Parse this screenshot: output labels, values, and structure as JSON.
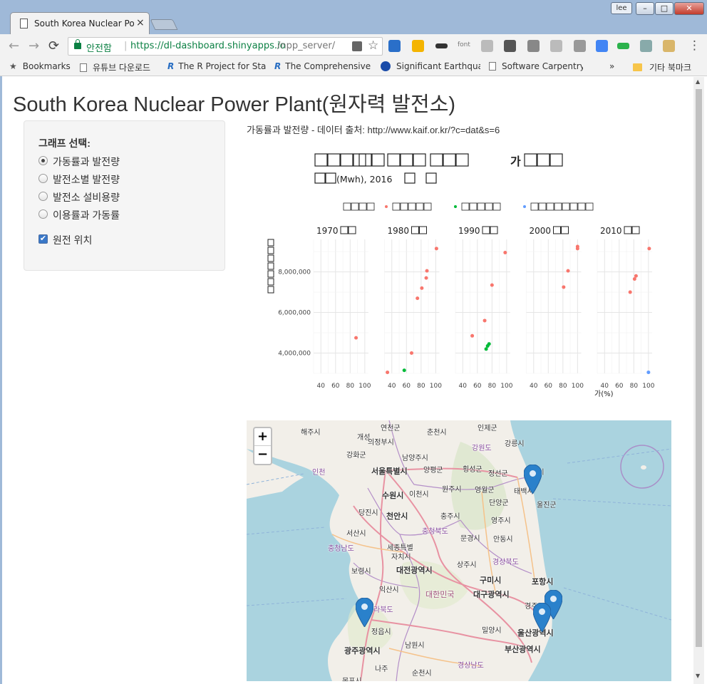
{
  "browser": {
    "tab_title": "South Korea Nuclear Po",
    "tab_close": "×",
    "user": "lee",
    "window_buttons": [
      "–",
      "□",
      "✕"
    ],
    "nav_back": "←",
    "nav_forward": "→",
    "nav_reload": "⟳",
    "secure_label": "안전함",
    "url_separator": "|",
    "url_host": "https://dl-dashboard.shinyapps.io",
    "url_path": "/npp_server/",
    "font_ext_label": "font",
    "bookmarks": [
      {
        "icon": "star-icon",
        "label": "Bookmarks"
      },
      {
        "icon": "page-icon",
        "label": "유튜브 다운로드"
      },
      {
        "icon": "r-logo-icon",
        "label": "The R Project for Sta"
      },
      {
        "icon": "r-logo-icon",
        "label": "The Comprehensive"
      },
      {
        "icon": "usgs-globe-icon",
        "label": "Significant Earthquak"
      },
      {
        "icon": "page-icon",
        "label": "Software Carpentry:"
      }
    ],
    "bookmarks_overflow": "»",
    "other_bookmarks": "기타 북마크"
  },
  "page": {
    "title": "South Korea Nuclear Power Plant(원자력 발전소)",
    "sidebar": {
      "label": "그래프 선택:",
      "options": [
        {
          "label": "가동률과 발전량",
          "selected": true
        },
        {
          "label": "발전소별 발전량",
          "selected": false
        },
        {
          "label": "발전소 설비용량",
          "selected": false
        },
        {
          "label": "이용률과 가동률",
          "selected": false
        }
      ],
      "checkbox": {
        "label": "원전 위치",
        "checked": true
      }
    },
    "source_text": "가동률과 발전량 - 데이터 출처: http://www.kaif.or.kr/?c=dat&s=6"
  },
  "chart_data": {
    "type": "scatter",
    "title": "",
    "subtitle": "(Mwh), 2016",
    "facets": [
      "1970",
      "1980",
      "1990",
      "2000",
      "2010"
    ],
    "xlim": [
      30,
      105
    ],
    "ylim": [
      3000000,
      9600000
    ],
    "x_ticks": [
      40,
      60,
      80,
      100
    ],
    "y_ticks": [
      4000000,
      6000000,
      8000000
    ],
    "y_tick_labels": [
      "4,000,000",
      "6,000,000",
      "8,000,000"
    ],
    "xlabel": "가(%)",
    "ylabel": "",
    "legend_position": "top",
    "grid": true,
    "series": [
      {
        "color": "#f8766d",
        "points": [
          {
            "facet": 0,
            "x": 88,
            "y": 4750000
          },
          {
            "facet": 1,
            "x": 34,
            "y": 3050000
          },
          {
            "facet": 1,
            "x": 67,
            "y": 4000000
          },
          {
            "facet": 1,
            "x": 75,
            "y": 6700000
          },
          {
            "facet": 1,
            "x": 81,
            "y": 7200000
          },
          {
            "facet": 1,
            "x": 87,
            "y": 7700000
          },
          {
            "facet": 1,
            "x": 88,
            "y": 8050000
          },
          {
            "facet": 1,
            "x": 101,
            "y": 9150000
          },
          {
            "facet": 2,
            "x": 53,
            "y": 4850000
          },
          {
            "facet": 2,
            "x": 70,
            "y": 5600000
          },
          {
            "facet": 2,
            "x": 80,
            "y": 7350000
          },
          {
            "facet": 2,
            "x": 98,
            "y": 8950000
          },
          {
            "facet": 3,
            "x": 81,
            "y": 7250000
          },
          {
            "facet": 3,
            "x": 87,
            "y": 8050000
          },
          {
            "facet": 3,
            "x": 100,
            "y": 9150000
          },
          {
            "facet": 3,
            "x": 100,
            "y": 9250000
          },
          {
            "facet": 4,
            "x": 75,
            "y": 7000000
          },
          {
            "facet": 4,
            "x": 81,
            "y": 7650000
          },
          {
            "facet": 4,
            "x": 83,
            "y": 7800000
          },
          {
            "facet": 4,
            "x": 101,
            "y": 9150000
          }
        ]
      },
      {
        "color": "#00ba38",
        "points": [
          {
            "facet": 1,
            "x": 57,
            "y": 3150000
          },
          {
            "facet": 2,
            "x": 72,
            "y": 4200000
          },
          {
            "facet": 2,
            "x": 74,
            "y": 4350000
          },
          {
            "facet": 2,
            "x": 76,
            "y": 4450000
          }
        ]
      },
      {
        "color": "#619cff",
        "points": [
          {
            "facet": 4,
            "x": 100,
            "y": 3050000
          }
        ]
      }
    ]
  },
  "map": {
    "zoom_in": "+",
    "zoom_out": "−",
    "labels": [
      {
        "text": "연천군",
        "cls": "",
        "left": 0
      },
      {
        "text": "해주시",
        "cls": ""
      },
      {
        "text": "춘천시",
        "cls": ""
      },
      {
        "text": "인제군",
        "cls": ""
      },
      {
        "text": "개성",
        "cls": ""
      },
      {
        "text": "의정부시",
        "cls": ""
      },
      {
        "text": "강원도",
        "cls": "prov"
      },
      {
        "text": "강릉시",
        "cls": ""
      },
      {
        "text": "강화군",
        "cls": ""
      },
      {
        "text": "남양주시",
        "cls": ""
      },
      {
        "text": "인천",
        "cls": "prov"
      },
      {
        "text": "서울특별시",
        "cls": "big"
      },
      {
        "text": "양평군",
        "cls": ""
      },
      {
        "text": "횡성군",
        "cls": ""
      },
      {
        "text": "정선군",
        "cls": ""
      },
      {
        "text": "삼척시",
        "cls": ""
      },
      {
        "text": "수원시",
        "cls": "big"
      },
      {
        "text": "이천시",
        "cls": ""
      },
      {
        "text": "원주시",
        "cls": ""
      },
      {
        "text": "영월군",
        "cls": ""
      },
      {
        "text": "태백시",
        "cls": ""
      },
      {
        "text": "울진군",
        "cls": ""
      },
      {
        "text": "당진시",
        "cls": ""
      },
      {
        "text": "천안시",
        "cls": "big"
      },
      {
        "text": "단양군",
        "cls": ""
      },
      {
        "text": "충주시",
        "cls": ""
      },
      {
        "text": "영주시",
        "cls": ""
      },
      {
        "text": "충청북도",
        "cls": "prov"
      },
      {
        "text": "서산시",
        "cls": ""
      },
      {
        "text": "문경시",
        "cls": ""
      },
      {
        "text": "안동시",
        "cls": ""
      },
      {
        "text": "충청남도",
        "cls": "prov"
      },
      {
        "text": "세종특별",
        "cls": ""
      },
      {
        "text": "자치시",
        "cls": ""
      },
      {
        "text": "경상북도",
        "cls": "prov"
      },
      {
        "text": "보령시",
        "cls": ""
      },
      {
        "text": "대전광역시",
        "cls": "big"
      },
      {
        "text": "상주시",
        "cls": ""
      },
      {
        "text": "구미시",
        "cls": "big"
      },
      {
        "text": "포항시",
        "cls": "big"
      },
      {
        "text": "익산시",
        "cls": ""
      },
      {
        "text": "대한민국",
        "cls": "country"
      },
      {
        "text": "대구광역시",
        "cls": "big"
      },
      {
        "text": "경주",
        "cls": ""
      },
      {
        "text": "라북도",
        "cls": "prov"
      },
      {
        "text": "정읍시",
        "cls": ""
      },
      {
        "text": "밀양시",
        "cls": ""
      },
      {
        "text": "울산광역시",
        "cls": "big"
      },
      {
        "text": "광주광역시",
        "cls": "big"
      },
      {
        "text": "남원시",
        "cls": ""
      },
      {
        "text": "부산광역시",
        "cls": "big"
      },
      {
        "text": "나주",
        "cls": ""
      },
      {
        "text": "순천시",
        "cls": ""
      },
      {
        "text": "경상남도",
        "cls": "prov"
      },
      {
        "text": "목포시",
        "cls": ""
      }
    ],
    "marker_color": "#2a81cb"
  }
}
